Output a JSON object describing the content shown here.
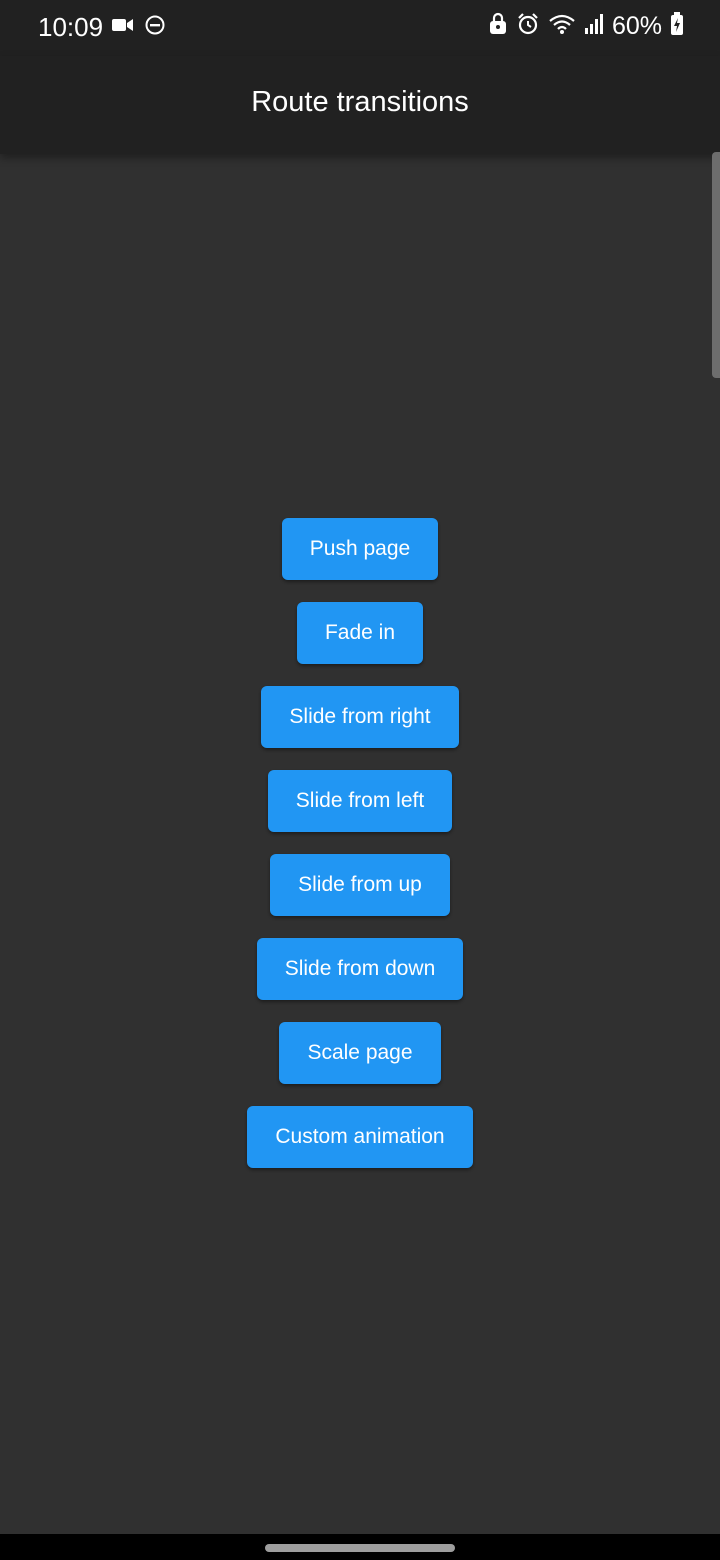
{
  "status_bar": {
    "time": "10:09",
    "battery": "60%",
    "left_icons": [
      "video-camera-icon",
      "do-not-disturb-icon"
    ],
    "right_icons": [
      "lock-icon",
      "alarm-icon",
      "wifi-icon",
      "signal-icon",
      "battery-icon"
    ]
  },
  "app_bar": {
    "title": "Route transitions"
  },
  "buttons": [
    "Push page",
    "Fade in",
    "Slide from right",
    "Slide from left",
    "Slide from up",
    "Slide from down",
    "Scale page",
    "Custom animation"
  ],
  "colors": {
    "background": "#303030",
    "app_bar": "#212121",
    "button": "#2196f3",
    "text": "#ffffff"
  }
}
